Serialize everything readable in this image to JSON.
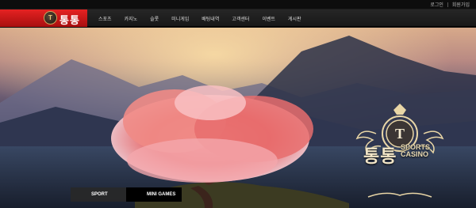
{
  "topbar": {
    "login": "로그인",
    "register": "회원가입"
  },
  "logo": {
    "mark": "T",
    "text": "통통"
  },
  "nav": {
    "items": [
      {
        "label": "스포츠",
        "key": "sports"
      },
      {
        "label": "카지노",
        "key": "casino"
      },
      {
        "label": "슬롯",
        "key": "slot"
      },
      {
        "label": "미니게임",
        "key": "minigame"
      },
      {
        "label": "배팅내역",
        "key": "bet-history"
      },
      {
        "label": "고객센터",
        "key": "customer-center"
      },
      {
        "label": "이벤트",
        "key": "event"
      },
      {
        "label": "게시판",
        "key": "board"
      }
    ]
  },
  "emblem": {
    "letter": "T",
    "title": "통통",
    "sub_line1": "SPORTS",
    "sub_line2": "CASINO"
  },
  "tabs": {
    "sport": "SPORT",
    "mini": "MINI GAMES"
  },
  "colors": {
    "brand_red": "#d81b1b",
    "gold": "#c9a55c",
    "nav_bg": "#1e1e1e"
  }
}
